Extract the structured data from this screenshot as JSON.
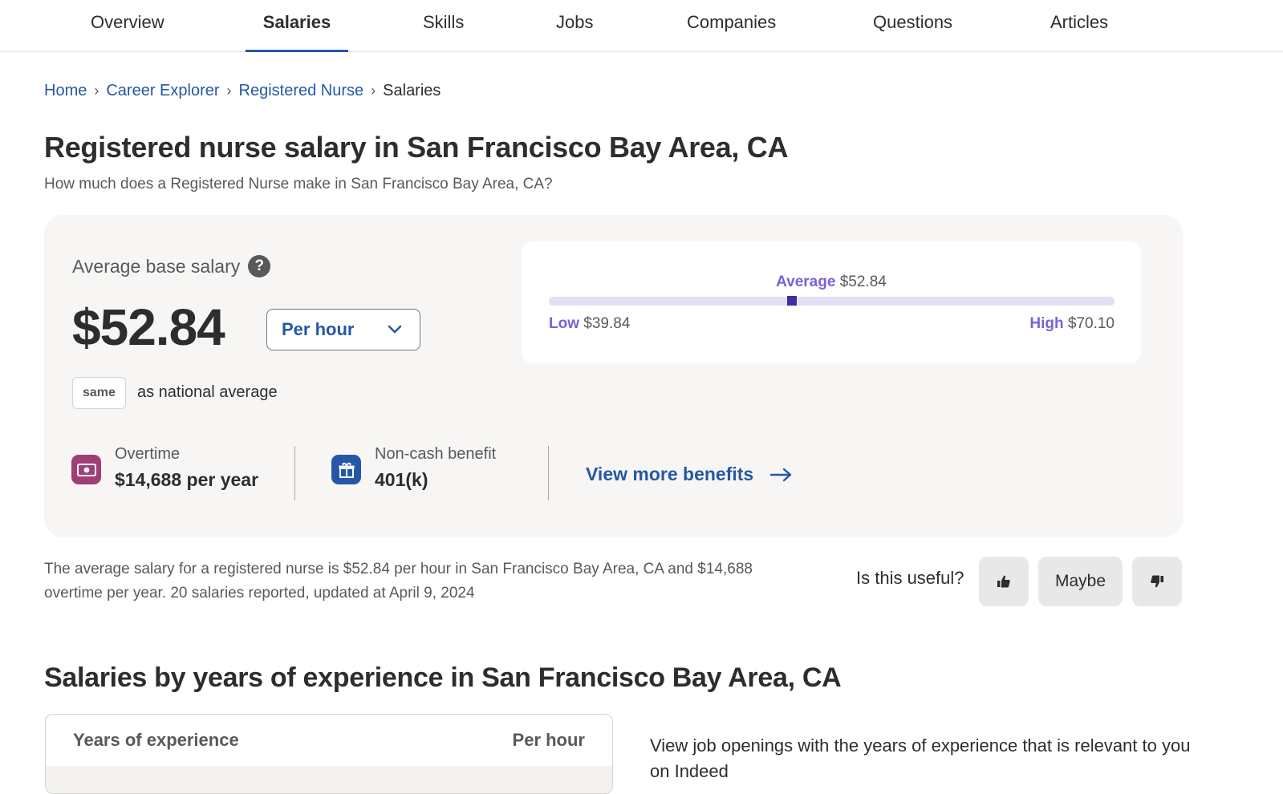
{
  "nav": {
    "tabs": [
      {
        "label": "Overview"
      },
      {
        "label": "Salaries",
        "active": true
      },
      {
        "label": "Skills"
      },
      {
        "label": "Jobs"
      },
      {
        "label": "Companies"
      },
      {
        "label": "Questions"
      },
      {
        "label": "Articles"
      }
    ]
  },
  "breadcrumb": {
    "items": [
      "Home",
      "Career Explorer",
      "Registered Nurse"
    ],
    "current": "Salaries"
  },
  "page": {
    "title": "Registered nurse salary in San Francisco Bay Area, CA",
    "subtitle": "How much does a Registered Nurse make in San Francisco Bay Area, CA?"
  },
  "salary_card": {
    "avg_label": "Average base salary",
    "help_icon": "?",
    "amount": "$52.84",
    "period": "Per hour",
    "comparison_badge": "same",
    "comparison_text": "as national average",
    "range": {
      "avg_label": "Average",
      "avg_value": "$52.84",
      "low_label": "Low",
      "low_value": "$39.84",
      "high_label": "High",
      "high_value": "$70.10",
      "marker_fraction": 0.43
    },
    "overtime": {
      "label": "Overtime",
      "value": "$14,688 per year",
      "icon": "cash-icon",
      "color": "#a03f73"
    },
    "benefit": {
      "label": "Non-cash benefit",
      "value": "401(k)",
      "icon": "gift-icon",
      "color": "#2557a7"
    },
    "view_more": "View more benefits"
  },
  "summary": {
    "text": "The average salary for a registered nurse is $52.84 per hour in San Francisco Bay Area, CA and $14,688 overtime per year.  20 salaries reported, updated at April 9, 2024"
  },
  "feedback": {
    "question": "Is this useful?",
    "maybe": "Maybe"
  },
  "experience_section": {
    "title": "Salaries by years of experience in San Francisco Bay Area, CA",
    "col_years": "Years of experience",
    "col_rate": "Per hour",
    "side_text": "View job openings with the years of experience that is relevant to you on Indeed"
  },
  "colors": {
    "accent": "#2557a7",
    "range_purple": "#7b61d9",
    "marker": "#3c2fa0"
  }
}
